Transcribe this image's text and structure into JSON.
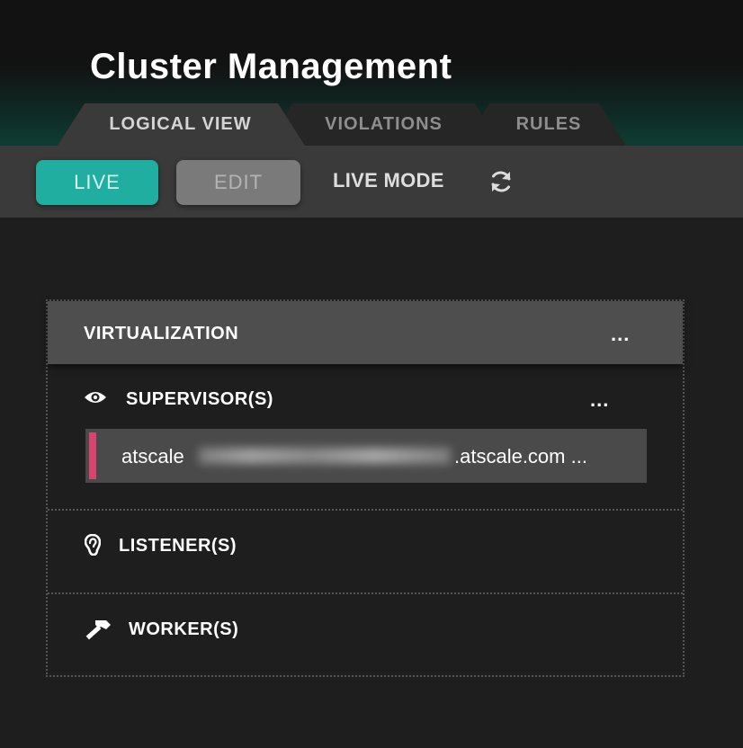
{
  "header": {
    "title": "Cluster Management"
  },
  "tabs": [
    {
      "label": "LOGICAL VIEW"
    },
    {
      "label": "VIOLATIONS"
    },
    {
      "label": "RULES"
    }
  ],
  "toolbar": {
    "live_label": "LIVE",
    "edit_label": "EDIT",
    "mode_label": "LIVE MODE",
    "refresh_icon": "refresh-icon"
  },
  "panel": {
    "title": "VIRTUALIZATION",
    "menu": "...",
    "sections": [
      {
        "title": "SUPERVISOR(S)",
        "icon": "eye-icon",
        "menu": "...",
        "rows": [
          {
            "host_prefix": "atscale",
            "host_suffix": ".atscale.com ...",
            "status_color": "#d9446e"
          }
        ]
      },
      {
        "title": "LISTENER(S)",
        "icon": "ear-icon"
      },
      {
        "title": "WORKER(S)",
        "icon": "hammer-icon"
      }
    ]
  },
  "colors": {
    "accent": "#1faea0",
    "panel_header": "#4e4e4e",
    "toolbar": "#3a3a3a",
    "background": "#1e1e1e"
  }
}
